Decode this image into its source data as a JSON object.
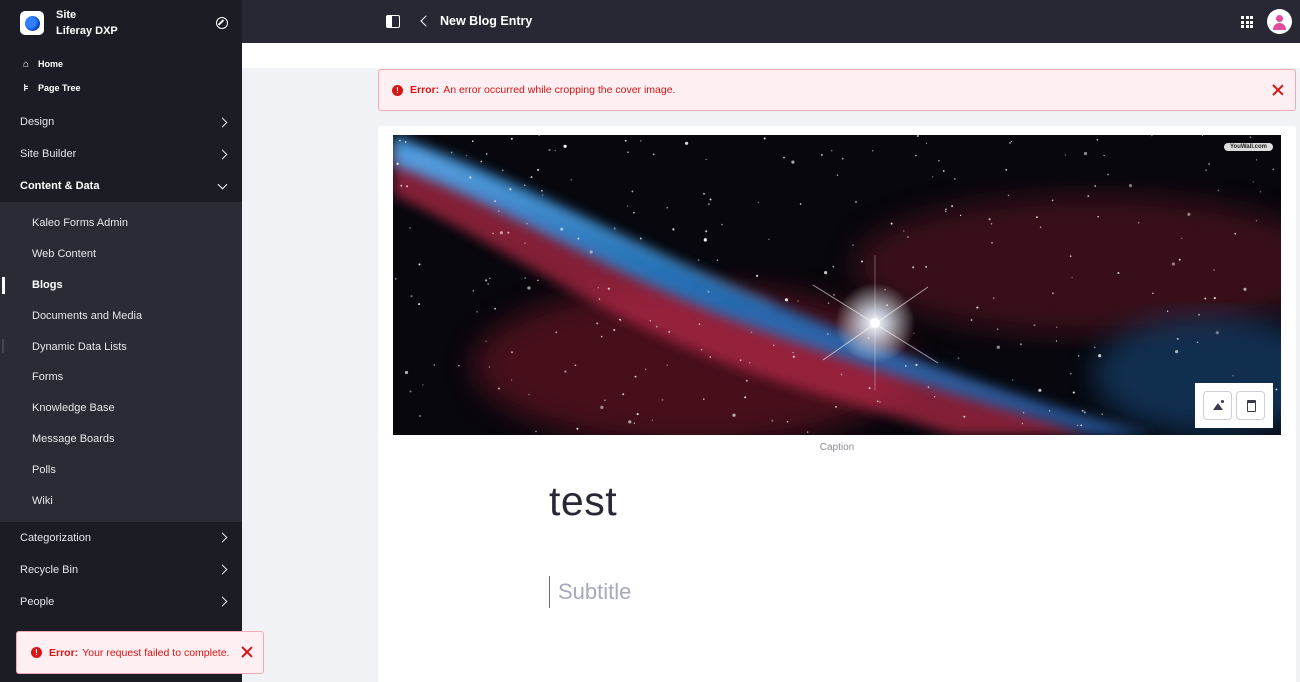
{
  "site": {
    "line1": "Site",
    "line2": "Liferay DXP"
  },
  "top_links": [
    {
      "label": "Home",
      "icon": "home-icon"
    },
    {
      "label": "Page Tree",
      "icon": "page-tree-icon"
    }
  ],
  "sections": {
    "design": "Design",
    "site_builder": "Site Builder",
    "content_data": "Content & Data",
    "categorization": "Categorization",
    "recycle_bin": "Recycle Bin",
    "people": "People"
  },
  "content_items": [
    "Kaleo Forms Admin",
    "Web Content",
    "Blogs",
    "Documents and Media",
    "Dynamic Data Lists",
    "Forms",
    "Knowledge Base",
    "Message Boards",
    "Polls",
    "Wiki"
  ],
  "header": {
    "title": "New Blog Entry"
  },
  "alerts": {
    "top": {
      "label": "Error:",
      "message": "An error occurred while cropping the cover image."
    },
    "bottom": {
      "label": "Error:",
      "message": "Your request failed to complete."
    }
  },
  "entry": {
    "watermark": "YouWall.com",
    "caption": "Caption",
    "title": "test",
    "subtitle_placeholder": "Subtitle"
  },
  "colors": {
    "sidebar": "#1c1c24",
    "topbar": "#272833",
    "error": "#da1414",
    "error_bg": "#feeff2"
  }
}
